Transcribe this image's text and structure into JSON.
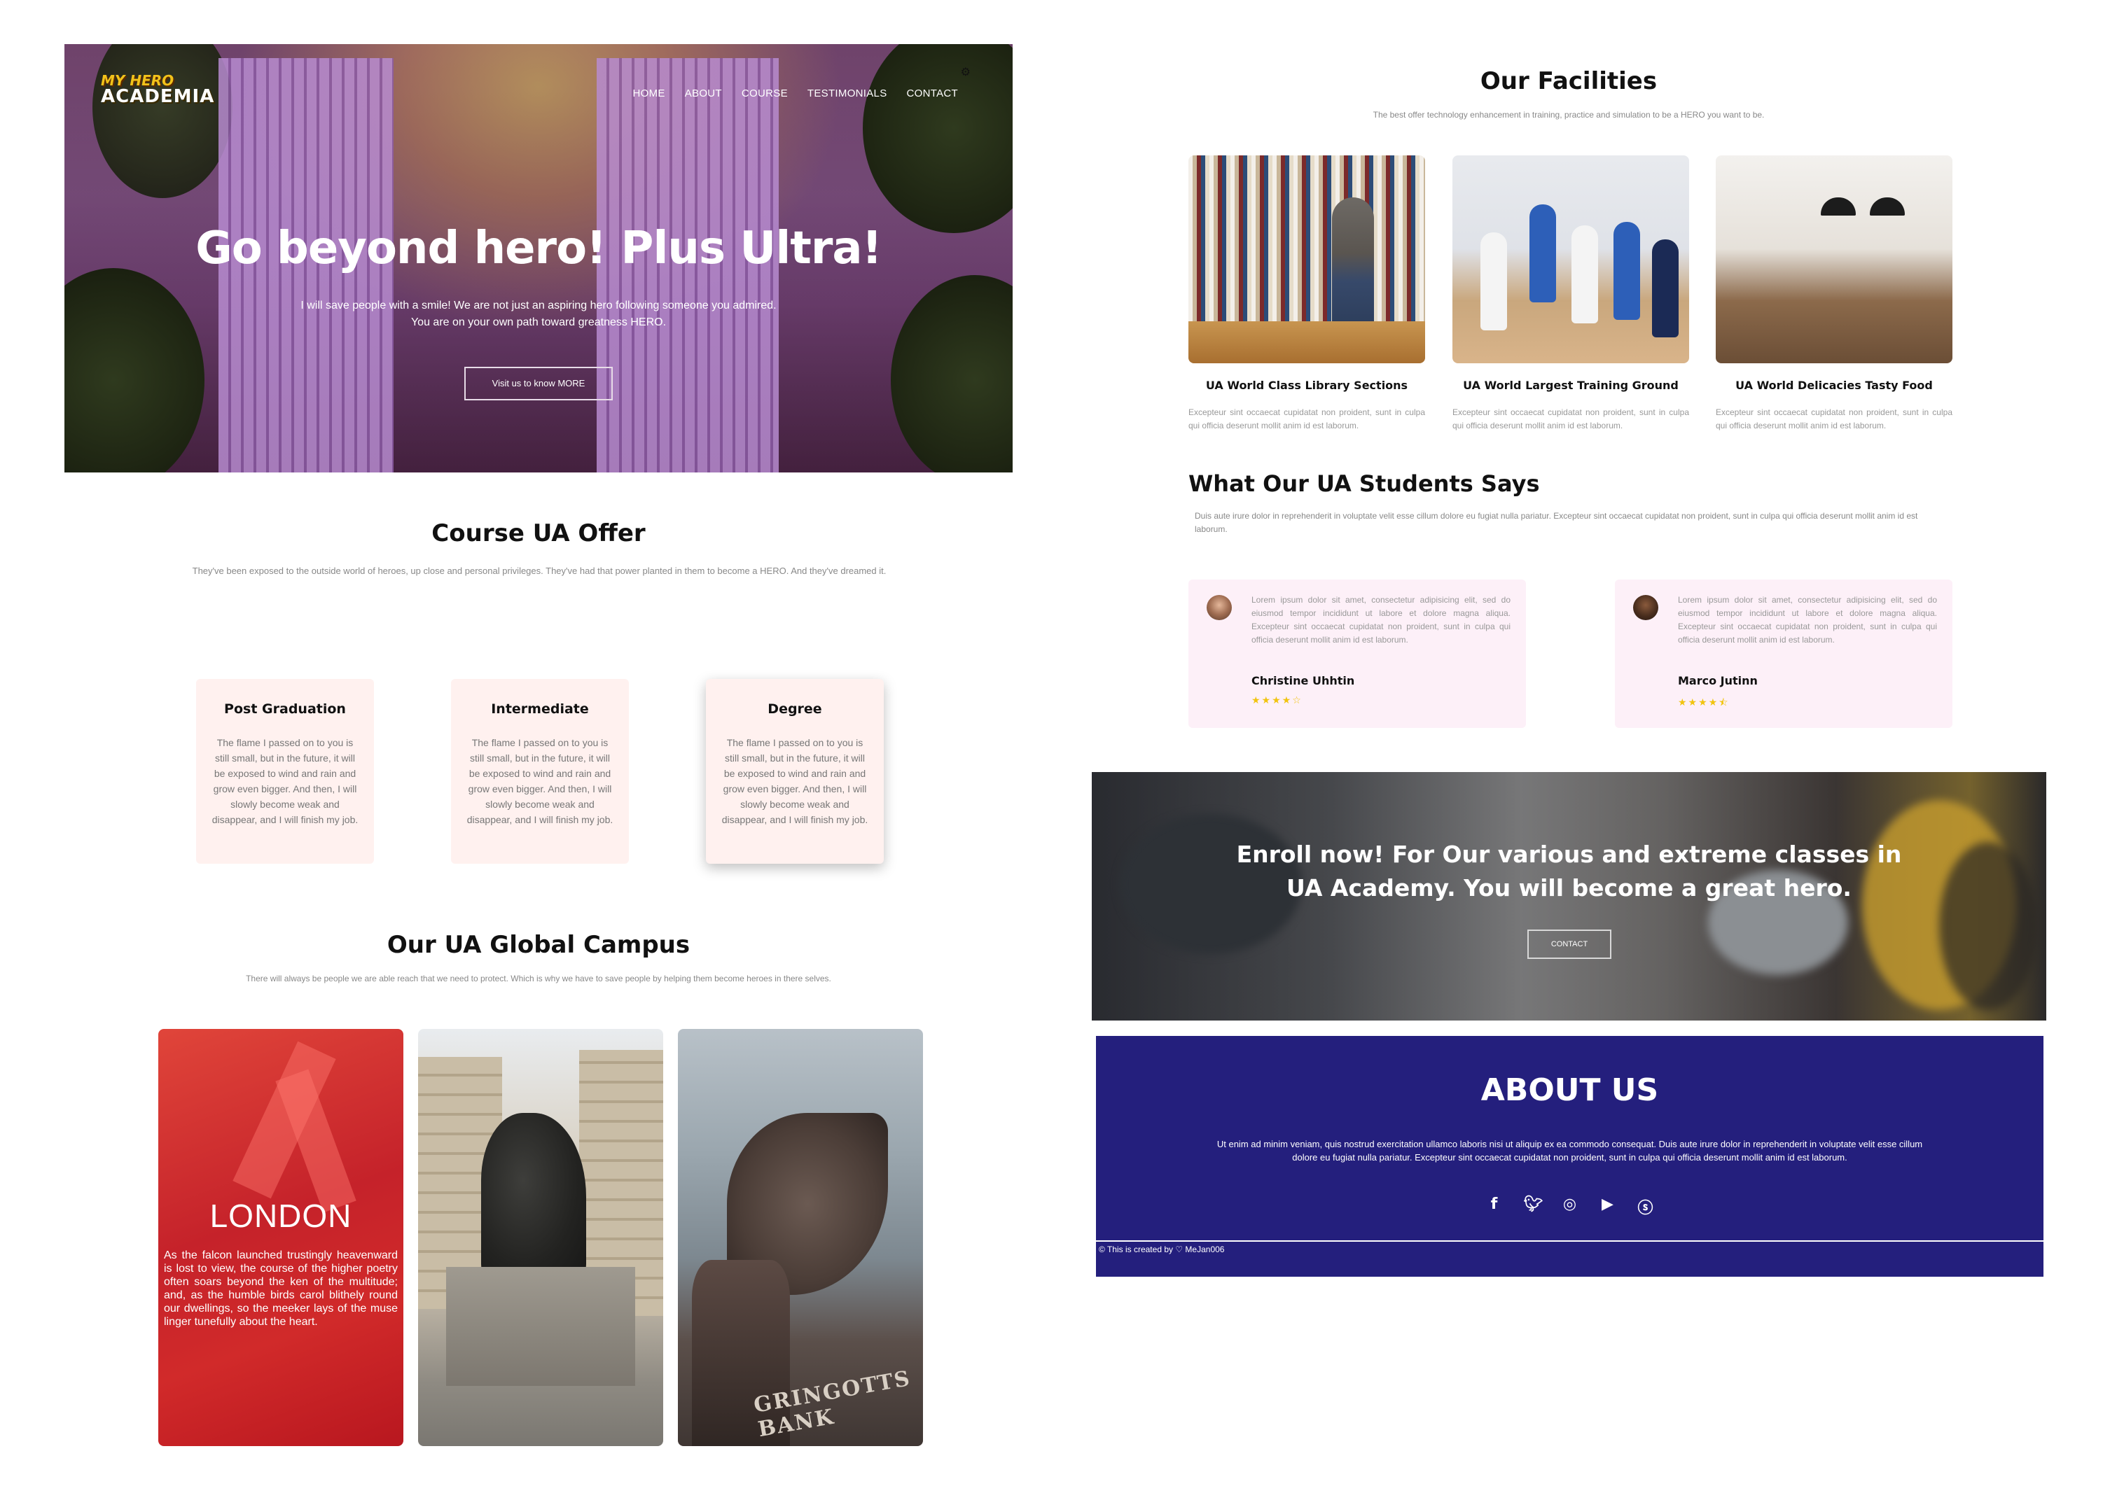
{
  "hero": {
    "logo_top": "MY HERO",
    "logo_bottom": "ACADEMIA",
    "nav": [
      "HOME",
      "ABOUT",
      "COURSE",
      "TESTIMONIALS",
      "CONTACT"
    ],
    "title": "Go beyond hero! Plus Ultra!",
    "subtitle_line1": "I will save people with a smile! We are not just an aspiring hero following someone you admired.",
    "subtitle_line2": "You are on your own path toward greatness HERO.",
    "button": "Visit us to know MORE"
  },
  "courses": {
    "title": "Course UA Offer",
    "subtitle": "They've been exposed to the outside world of heroes, up close and personal privileges. They've had that power planted in them to become a HERO. And they've dreamed it.",
    "items": [
      {
        "name": "Post Graduation",
        "text": "The flame I passed on to you is still small, but in the future, it will be exposed to wind and rain and grow even bigger. And then, I will slowly become weak and disappear, and I will finish my job."
      },
      {
        "name": "Intermediate",
        "text": "The flame I passed on to you is still small, but in the future, it will be exposed to wind and rain and grow even bigger. And then, I will slowly become weak and disappear, and I will finish my job."
      },
      {
        "name": "Degree",
        "text": "The flame I passed on to you is still small, but in the future, it will be exposed to wind and rain and grow even bigger. And then, I will slowly become weak and disappear, and I will finish my job."
      }
    ]
  },
  "campus": {
    "title": "Our UA Global Campus",
    "subtitle": "There will always be people we are able reach that we need to protect. Which is why we have to save people by helping them become heroes in there selves.",
    "london_title": "LONDON",
    "london_text": "As the falcon launched trustingly heavenward is lost to view, the course of the higher poetry often soars beyond the ken of the multitude; and, as the humble birds carol blithely round our dwellings, so the meeker lays of the muse linger tunefully about the heart.",
    "bank_sign": "GRINGOTTS BANK"
  },
  "facilities": {
    "title": "Our Facilities",
    "subtitle": "The best offer technology enhancement in training, practice and simulation to be a HERO you want to be.",
    "items": [
      {
        "name": "UA World Class Library Sections",
        "text": "Excepteur sint occaecat cupidatat non proident, sunt in culpa qui officia deserunt mollit anim id est laborum."
      },
      {
        "name": "UA World Largest Training Ground",
        "text": "Excepteur sint occaecat cupidatat non proident, sunt in culpa qui officia deserunt mollit anim id est laborum."
      },
      {
        "name": "UA World Delicacies Tasty Food",
        "text": "Excepteur sint occaecat cupidatat non proident, sunt in culpa qui officia deserunt mollit anim id est laborum."
      }
    ]
  },
  "testimonials": {
    "title": "What Our UA Students Says",
    "subtitle": "Duis aute irure dolor in reprehenderit in voluptate velit esse cillum dolore eu fugiat nulla pariatur. Excepteur sint occaecat cupidatat non proident, sunt in culpa qui officia deserunt mollit anim id est laborum.",
    "items": [
      {
        "text": "Lorem ipsum dolor sit amet, consectetur adipisicing elit, sed do eiusmod tempor incididunt ut labore et dolore magna aliqua. Excepteur sint occaecat cupidatat non proident, sunt in culpa qui officia deserunt mollit anim id est laborum.",
        "name": "Christine Uhhtin",
        "stars": "★★★★☆",
        "rating": 4
      },
      {
        "text": "Lorem ipsum dolor sit amet, consectetur adipisicing elit, sed do eiusmod tempor incididunt ut labore et dolore magna aliqua. Excepteur sint occaecat cupidatat non proident, sunt in culpa qui officia deserunt mollit anim id est laborum.",
        "name": "Marco Jutinn",
        "stars": "★★★★⯪",
        "rating": 4.5
      }
    ]
  },
  "enroll": {
    "line1": "Enroll now! For Our various and extreme classes in",
    "line2": "UA Academy. You will become a great hero.",
    "button": "CONTACT"
  },
  "about": {
    "title": "ABOUT US",
    "text": "Ut enim ad minim veniam, quis nostrud exercitation ullamco laboris nisi ut aliquip ex ea commodo consequat. Duis aute irure dolor in reprehenderit in voluptate velit esse cillum dolore eu fugiat nulla pariatur. Excepteur sint occaecat cupidatat non proident, sunt in culpa qui officia deserunt mollit anim id est laborum.",
    "social": [
      "facebook-icon",
      "twitter-icon",
      "instagram-icon",
      "youtube-icon",
      "skype-icon"
    ],
    "credit": "© This is created by ♡ MeJan006"
  },
  "colors": {
    "about_bg": "#241f7d",
    "course_card_bg": "#fff1ef",
    "testimonial_bg": "#fdf0f8",
    "star": "#f1c40f",
    "london_red": "#c5222a"
  }
}
